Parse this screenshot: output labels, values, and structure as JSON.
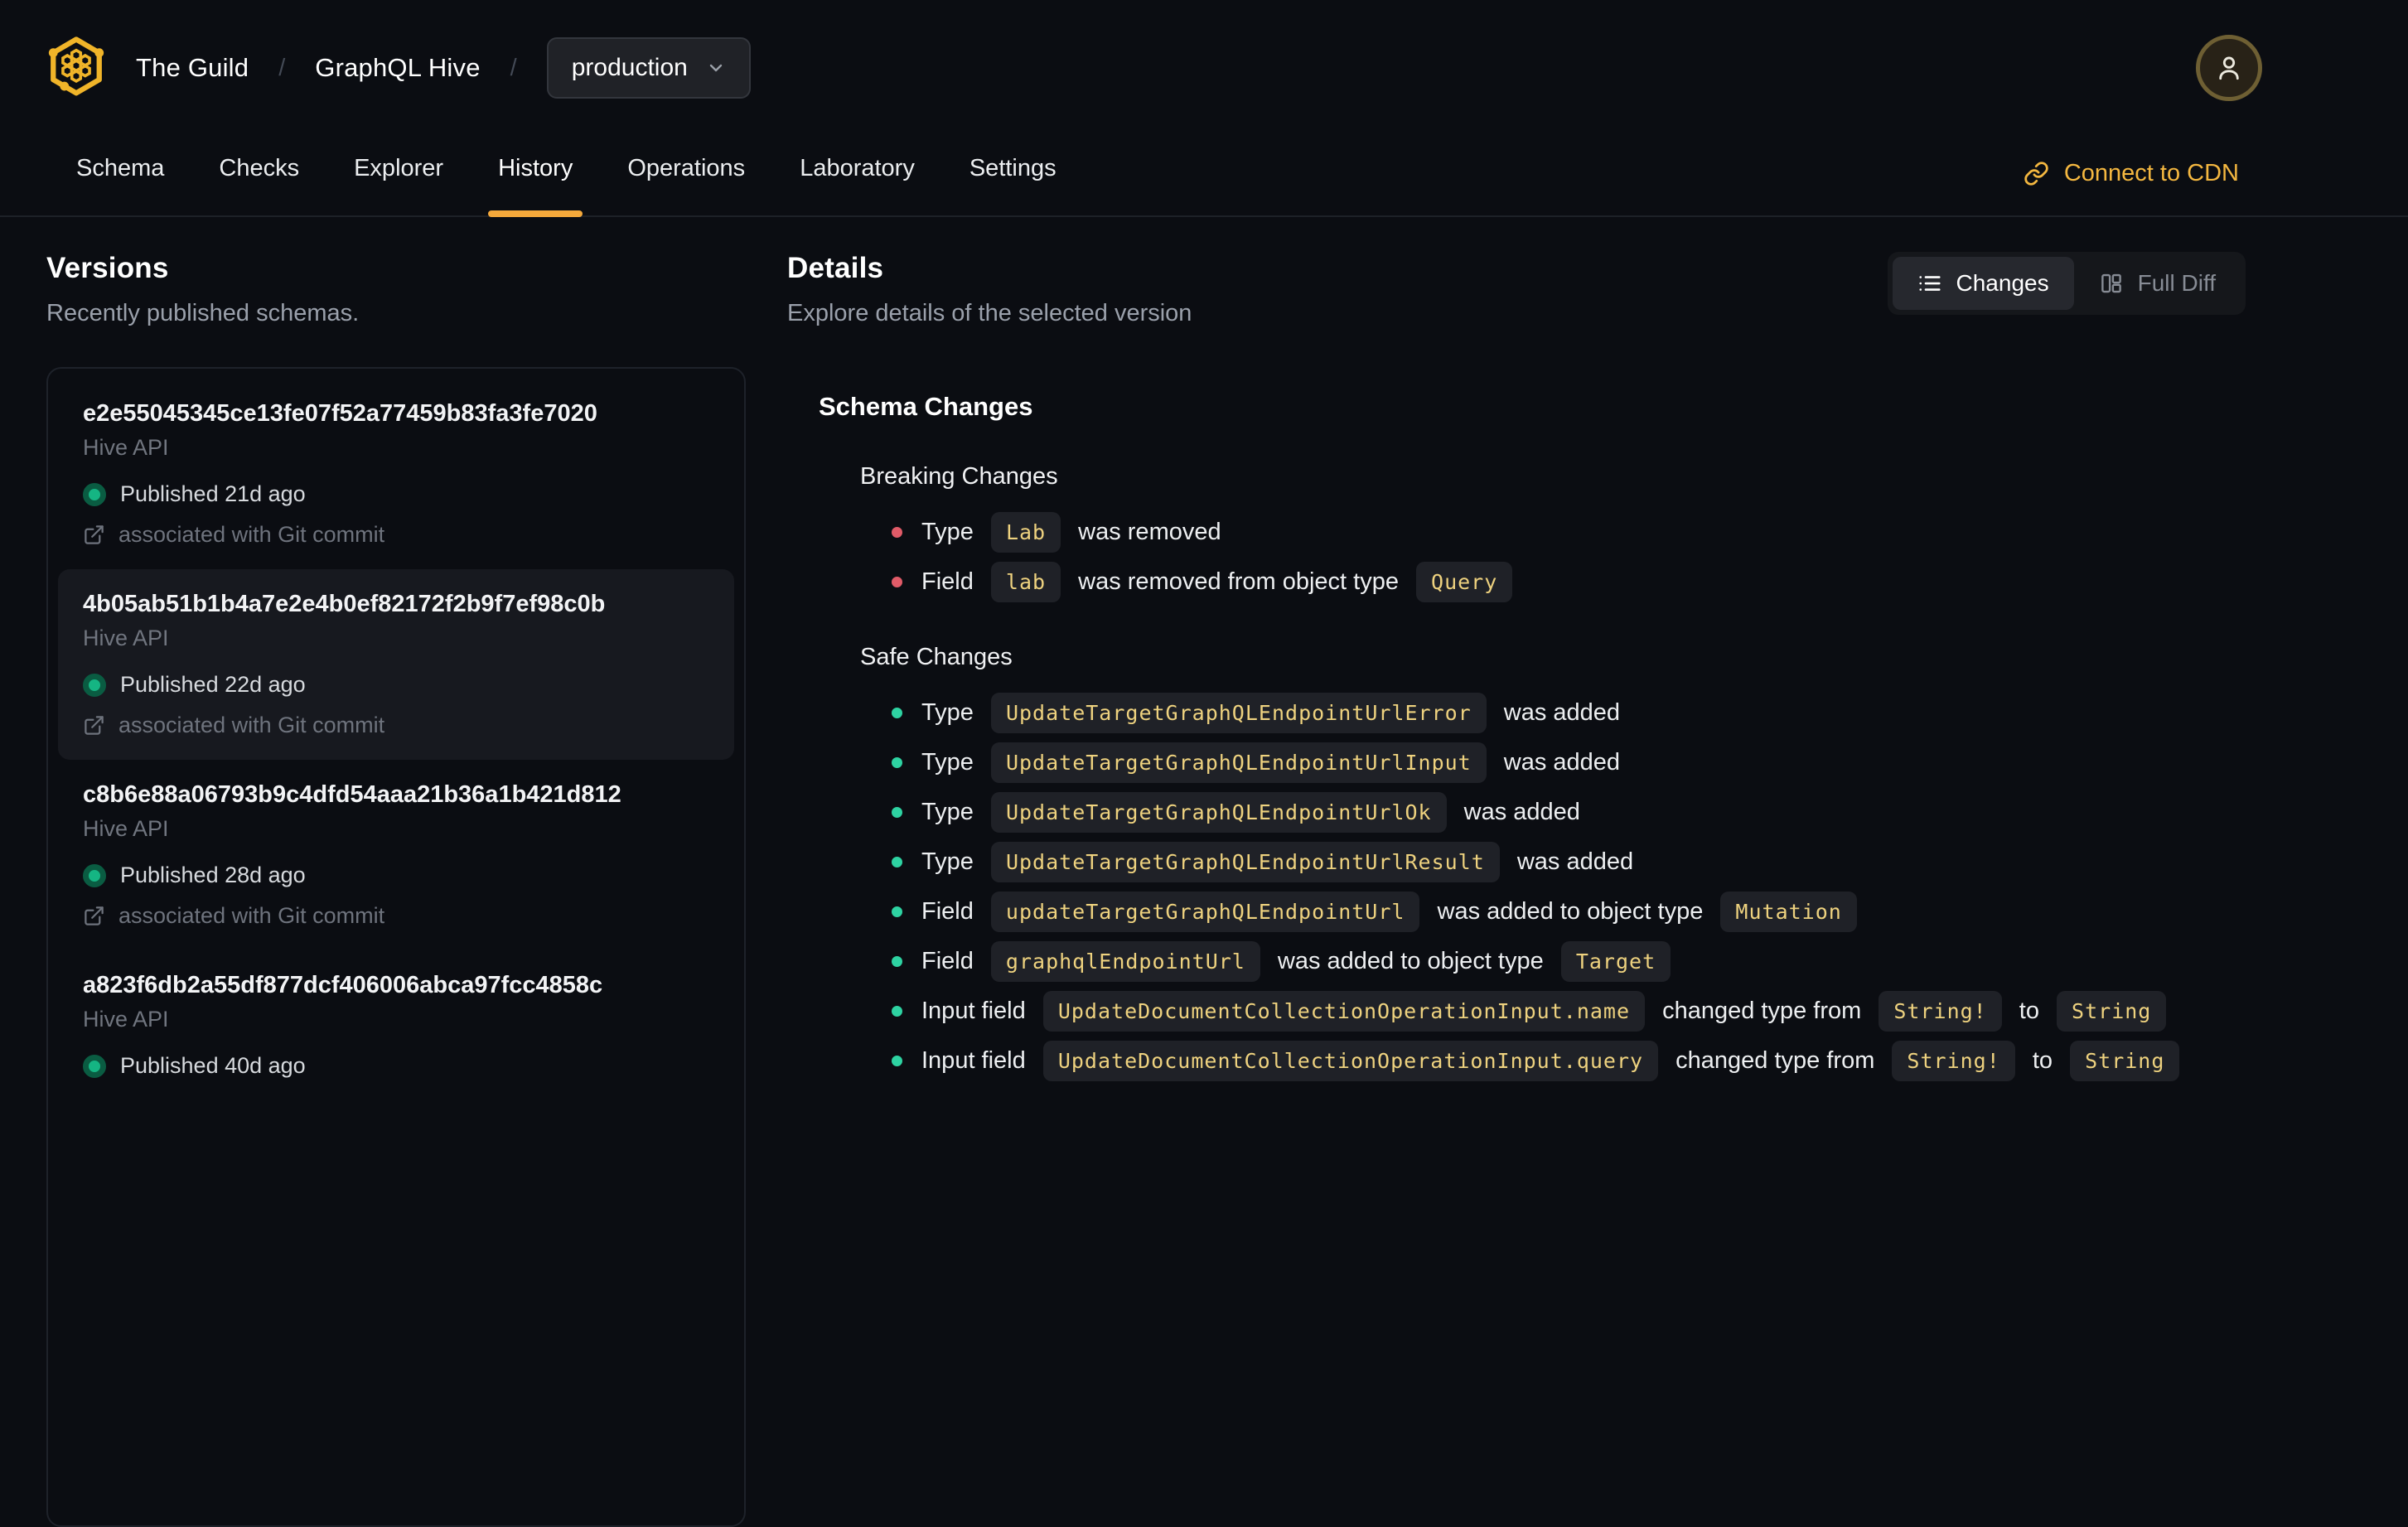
{
  "header": {
    "logo_icon": "hive-logo-icon",
    "org": "The Guild",
    "divider": "/",
    "project": "GraphQL Hive",
    "target_selector": {
      "value": "production",
      "icon": "chevron-down-icon"
    },
    "avatar_icon": "user-icon"
  },
  "nav": {
    "tabs": [
      {
        "label": "Schema"
      },
      {
        "label": "Checks"
      },
      {
        "label": "Explorer"
      },
      {
        "label": "History"
      },
      {
        "label": "Operations"
      },
      {
        "label": "Laboratory"
      },
      {
        "label": "Settings"
      }
    ],
    "active_tab": "History",
    "cdn_link": {
      "label": "Connect to CDN",
      "icon": "link-icon"
    }
  },
  "versions_panel": {
    "title": "Versions",
    "subtitle": "Recently published schemas.",
    "items": [
      {
        "hash": "e2e55045345ce13fe07f52a77459b83fa3fe7020",
        "service": "Hive API",
        "status": "Published 21d ago",
        "git": "associated with Git commit",
        "selected": false
      },
      {
        "hash": "4b05ab51b1b4a7e2e4b0ef82172f2b9f7ef98c0b",
        "service": "Hive API",
        "status": "Published 22d ago",
        "git": "associated with Git commit",
        "selected": true
      },
      {
        "hash": "c8b6e88a06793b9c4dfd54aaa21b36a1b421d812",
        "service": "Hive API",
        "status": "Published 28d ago",
        "git": "associated with Git commit",
        "selected": false
      },
      {
        "hash": "a823f6db2a55df877dcf406006abca97fcc4858c",
        "service": "Hive API",
        "status": "Published 40d ago",
        "git": "",
        "selected": false
      }
    ]
  },
  "details_panel": {
    "title": "Details",
    "subtitle": "Explore details of the selected version",
    "view_toggle": {
      "options": [
        {
          "label": "Changes",
          "icon": "list-icon"
        },
        {
          "label": "Full Diff",
          "icon": "columns-icon"
        }
      ],
      "active": "Changes"
    },
    "section_title": "Schema Changes",
    "breaking": {
      "title": "Breaking Changes",
      "items": [
        [
          {
            "t": "text",
            "v": "Type "
          },
          {
            "t": "code",
            "v": "Lab"
          },
          {
            "t": "text",
            "v": " was removed"
          }
        ],
        [
          {
            "t": "text",
            "v": "Field "
          },
          {
            "t": "code",
            "v": "lab"
          },
          {
            "t": "text",
            "v": " was removed from object type "
          },
          {
            "t": "code",
            "v": "Query"
          }
        ]
      ]
    },
    "safe": {
      "title": "Safe Changes",
      "items": [
        [
          {
            "t": "text",
            "v": "Type "
          },
          {
            "t": "code",
            "v": "UpdateTargetGraphQLEndpointUrlError"
          },
          {
            "t": "text",
            "v": " was added"
          }
        ],
        [
          {
            "t": "text",
            "v": "Type "
          },
          {
            "t": "code",
            "v": "UpdateTargetGraphQLEndpointUrlInput"
          },
          {
            "t": "text",
            "v": " was added"
          }
        ],
        [
          {
            "t": "text",
            "v": "Type "
          },
          {
            "t": "code",
            "v": "UpdateTargetGraphQLEndpointUrlOk"
          },
          {
            "t": "text",
            "v": " was added"
          }
        ],
        [
          {
            "t": "text",
            "v": "Type "
          },
          {
            "t": "code",
            "v": "UpdateTargetGraphQLEndpointUrlResult"
          },
          {
            "t": "text",
            "v": " was added"
          }
        ],
        [
          {
            "t": "text",
            "v": "Field "
          },
          {
            "t": "code",
            "v": "updateTargetGraphQLEndpointUrl"
          },
          {
            "t": "text",
            "v": " was added to object type "
          },
          {
            "t": "code",
            "v": "Mutation"
          }
        ],
        [
          {
            "t": "text",
            "v": "Field "
          },
          {
            "t": "code",
            "v": "graphqlEndpointUrl"
          },
          {
            "t": "text",
            "v": " was added to object type "
          },
          {
            "t": "code",
            "v": "Target"
          }
        ],
        [
          {
            "t": "text",
            "v": "Input field "
          },
          {
            "t": "code",
            "v": "UpdateDocumentCollectionOperationInput.name"
          },
          {
            "t": "text",
            "v": " changed type from "
          },
          {
            "t": "code",
            "v": "String!"
          },
          {
            "t": "text",
            "v": " to "
          },
          {
            "t": "code",
            "v": "String"
          }
        ],
        [
          {
            "t": "text",
            "v": "Input field "
          },
          {
            "t": "code",
            "v": "UpdateDocumentCollectionOperationInput.query"
          },
          {
            "t": "text",
            "v": " changed type from "
          },
          {
            "t": "code",
            "v": "String!"
          },
          {
            "t": "text",
            "v": " to "
          },
          {
            "t": "code",
            "v": "String"
          }
        ]
      ]
    }
  },
  "colors": {
    "background": "#0b0d12",
    "accent_underline": "#f5a93b",
    "cdn_link": "#f4b740",
    "logo": "#f0b429",
    "badge_text": "#eed27f",
    "badge_bg": "#1f2127",
    "breaking_bullet": "#e15b68",
    "safe_bullet": "#2ed3a2",
    "published_dot": "#15b583",
    "selected_card_bg": "#17191f"
  }
}
